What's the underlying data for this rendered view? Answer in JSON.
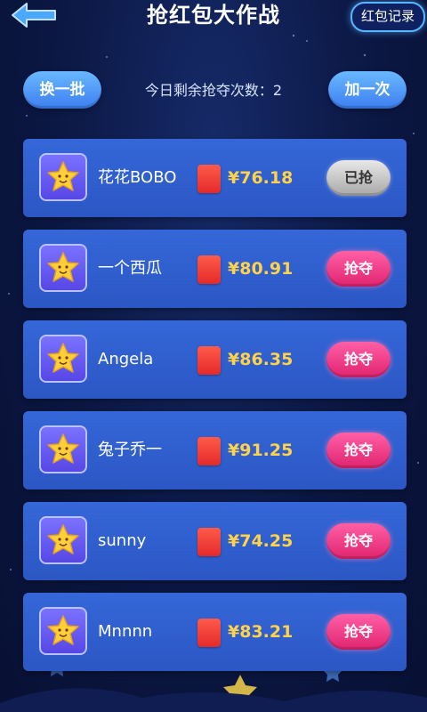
{
  "header": {
    "title": "抢红包大作战",
    "record_label": "红包记录"
  },
  "controls": {
    "swap_label": "换一批",
    "remaining_text": "今日剩余抢夺次数：2",
    "add_label": "加一次"
  },
  "colors": {
    "card": "#3567d8",
    "amount": "#ffd24a",
    "grab": "#e0246f",
    "done": "#a8a8a8"
  },
  "rows": [
    {
      "name": "花花BOBO",
      "amount": "¥76.18",
      "action": "已抢",
      "done": true
    },
    {
      "name": "一个西瓜",
      "amount": "¥80.91",
      "action": "抢夺",
      "done": false
    },
    {
      "name": "Angela",
      "amount": "¥86.35",
      "action": "抢夺",
      "done": false
    },
    {
      "name": "兔子乔一",
      "amount": "¥91.25",
      "action": "抢夺",
      "done": false
    },
    {
      "name": "sunny",
      "amount": "¥74.25",
      "action": "抢夺",
      "done": false
    },
    {
      "name": "Mnnnn",
      "amount": "¥83.21",
      "action": "抢夺",
      "done": false
    }
  ]
}
